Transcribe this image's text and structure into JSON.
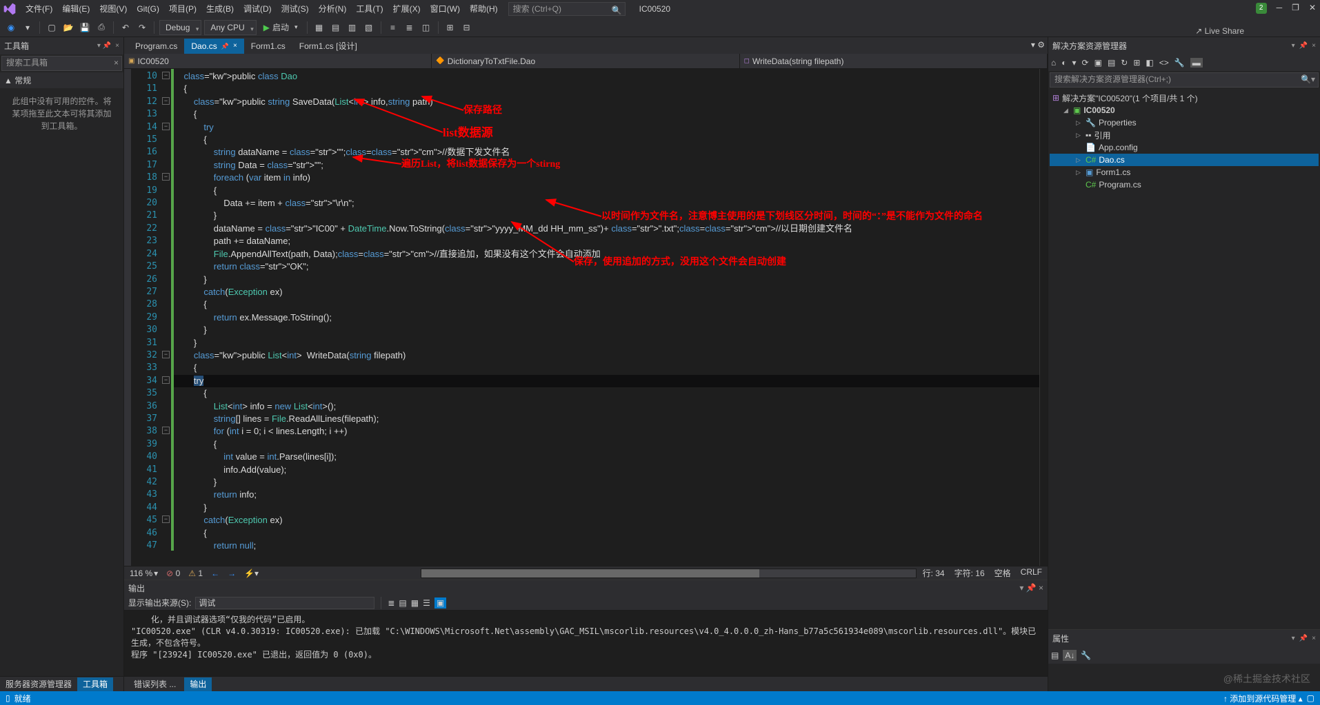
{
  "menu": {
    "items": [
      "文件(F)",
      "编辑(E)",
      "视图(V)",
      "Git(G)",
      "项目(P)",
      "生成(B)",
      "调试(D)",
      "测试(S)",
      "分析(N)",
      "工具(T)",
      "扩展(X)",
      "窗口(W)",
      "帮助(H)"
    ],
    "search_placeholder": "搜索 (Ctrl+Q)",
    "solution": "IC00520",
    "badge": "2"
  },
  "toolbar": {
    "config": "Debug",
    "platform": "Any CPU",
    "run": "启动",
    "liveshare": "Live Share"
  },
  "toolbox": {
    "title": "工具箱",
    "search": "搜索工具箱",
    "category": "▲ 常规",
    "message": "此组中没有可用的控件。将某项拖至此文本可将其添加到工具箱。"
  },
  "left_tabs": {
    "a": "服务器资源管理器",
    "b": "工具箱"
  },
  "tabs": [
    {
      "label": "Program.cs",
      "active": false,
      "pin": false
    },
    {
      "label": "Dao.cs",
      "active": true,
      "pin": true
    },
    {
      "label": "Form1.cs",
      "active": false,
      "pin": false
    },
    {
      "label": "Form1.cs [设计]",
      "active": false,
      "pin": false
    }
  ],
  "nav": {
    "scope": "IC00520",
    "cls": "DictionaryToTxtFile.Dao",
    "member": "WriteData(string filepath)"
  },
  "code": {
    "first_line": 10,
    "lines": [
      "public class Dao",
      "{",
      "    public string SaveData(List<int> info,string path)",
      "    {",
      "        try",
      "        {",
      "            string dataName = \"\";//数据下发文件名",
      "            string Data = \"\";",
      "            foreach (var item in info)",
      "            {",
      "                Data += item + \"\\r\\n\";",
      "            }",
      "            dataName = \"IC00\" + DateTime.Now.ToString(\"yyyy_MM_dd HH_mm_ss\")+ \".txt\";//以日期创建文件名",
      "            path += dataName;",
      "            File.AppendAllText(path, Data);//直接追加，如果没有这个文件会自动添加",
      "            return \"OK\";",
      "        }",
      "        catch(Exception ex)",
      "        {",
      "            return ex.Message.ToString();",
      "        }",
      "    }",
      "    public List<int>  WriteData(string filepath)",
      "    {",
      "        try",
      "        {",
      "            List<int> info = new List<int>();",
      "            string[] lines = File.ReadAllLines(filepath);",
      "            for (int i = 0; i < lines.Length; i ++)",
      "            {",
      "                int value = int.Parse(lines[i]);",
      "                info.Add(value);",
      "            }",
      "            return info;",
      "        }",
      "        catch(Exception ex)",
      "        {",
      "            return null;"
    ]
  },
  "annotations": {
    "a1": "保存路径",
    "a2": "list数据源",
    "a3": "遍历List，将list数据保存为一个stirng",
    "a4": "以时间作为文件名，注意博主使用的是下划线区分时间，时间的“：”是不能作为文件的命名",
    "a5": "保存，使用追加的方式，没用这个文件会自动创建"
  },
  "status": {
    "zoom": "116 %",
    "errors": "0",
    "warnings": "1",
    "line": "行: 34",
    "col": "字符: 16",
    "ins": "空格",
    "crlf": "CRLF"
  },
  "output": {
    "title": "输出",
    "source_label": "显示输出来源(S):",
    "source": "调试",
    "text": "    化，并且调试器选项“仅我的代码”已启用。\n\"IC00520.exe\" (CLR v4.0.30319: IC00520.exe): 已加载 \"C:\\WINDOWS\\Microsoft.Net\\assembly\\GAC_MSIL\\mscorlib.resources\\v4.0_4.0.0.0_zh-Hans_b77a5c561934e089\\mscorlib.resources.dll\"。模块已生成，不包含符号。\n程序 \"[23924] IC00520.exe\" 已退出，返回值为 0 (0x0)。"
  },
  "bottom_tabs": {
    "a": "错误列表 ...",
    "b": "输出"
  },
  "solution": {
    "title": "解决方案资源管理器",
    "search": "搜索解决方案资源管理器(Ctrl+;)",
    "root": "解决方案\"IC00520\"(1 个项目/共 1 个)",
    "project": "IC00520",
    "nodes": [
      "Properties",
      "引用",
      "App.config",
      "Dao.cs",
      "Form1.cs",
      "Program.cs"
    ]
  },
  "props": {
    "title": "属性"
  },
  "statusbar": {
    "ready": "就绪",
    "source": "添加到源代码管理"
  },
  "watermark": "@稀土掘金技术社区"
}
